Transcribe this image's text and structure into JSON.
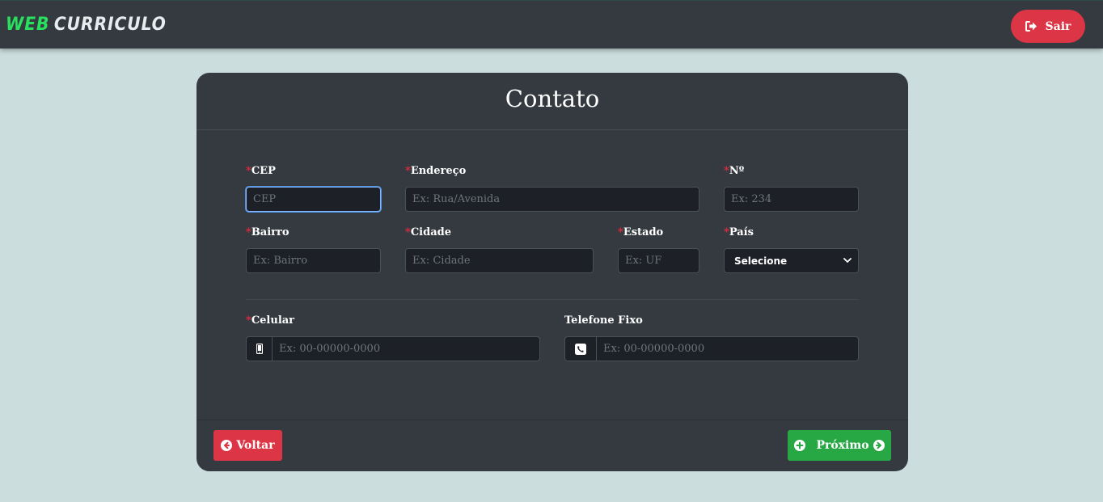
{
  "navbar": {
    "brand_part1": "WEB",
    "brand_part2": "CURRICULO",
    "logout_label": "Sair",
    "logout_icon": "sign-out-icon"
  },
  "card": {
    "title": "Contato"
  },
  "form": {
    "required_mark": "*",
    "cep": {
      "label": "CEP",
      "placeholder": "CEP",
      "value": ""
    },
    "endereco": {
      "label": "Endereço",
      "placeholder": "Ex: Rua/Avenida",
      "value": ""
    },
    "numero": {
      "label": "Nº",
      "placeholder": "Ex: 234",
      "value": ""
    },
    "bairro": {
      "label": "Bairro",
      "placeholder": "Ex: Bairro",
      "value": ""
    },
    "cidade": {
      "label": "Cidade",
      "placeholder": "Ex: Cidade",
      "value": ""
    },
    "estado": {
      "label": "Estado",
      "placeholder": "Ex: UF",
      "value": ""
    },
    "pais": {
      "label": "País",
      "selected": "Selecione"
    },
    "celular": {
      "label": "Celular",
      "placeholder": "Ex: 00-00000-0000",
      "value": "",
      "icon": "mobile-phone-icon"
    },
    "telefone_fixo": {
      "label": "Telefone Fixo",
      "placeholder": "Ex: 00-00000-0000",
      "value": "",
      "icon": "phone-square-icon"
    }
  },
  "footer": {
    "back_label": "Voltar",
    "next_label": "Próximo"
  },
  "colors": {
    "page_bg": "#cbdedd",
    "panel": "#343a40",
    "danger": "#dc3545",
    "success": "#28a745",
    "brand_green": "#28e05e"
  }
}
